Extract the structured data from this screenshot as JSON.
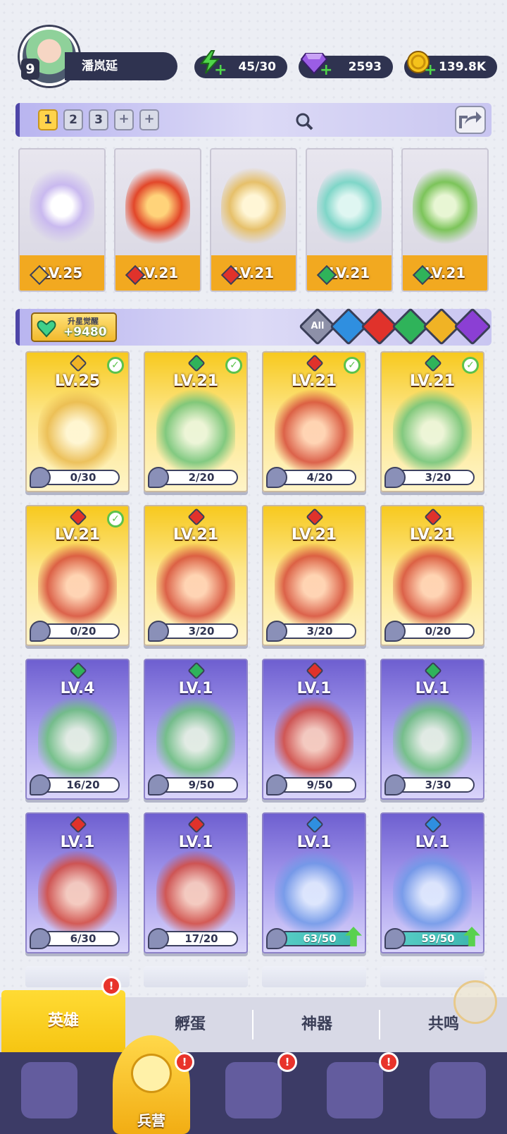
{
  "player": {
    "level": "9",
    "name": "潘岚延"
  },
  "resources": {
    "energy": "45/30",
    "gems": "2593",
    "gold": "139.8K"
  },
  "team": {
    "slots": [
      "1",
      "2",
      "3"
    ],
    "add_label": "+",
    "members": [
      {
        "level": "LV.25",
        "element": "light"
      },
      {
        "level": "LV.21",
        "element": "fire"
      },
      {
        "level": "LV.21",
        "element": "fire"
      },
      {
        "level": "LV.21",
        "element": "nature"
      },
      {
        "level": "LV.21",
        "element": "nature"
      }
    ]
  },
  "awaken": {
    "title": "升星觉醒",
    "value": "+9480"
  },
  "filters": [
    "All",
    "water",
    "fire",
    "nature",
    "light",
    "dark"
  ],
  "filter_all_label": "All",
  "heroes": [
    {
      "level": "LV.25",
      "progress": "0/30",
      "element": "light",
      "rarity": "gold",
      "checked": true,
      "upgrade": false
    },
    {
      "level": "LV.21",
      "progress": "2/20",
      "element": "nature",
      "rarity": "gold",
      "checked": true,
      "upgrade": false
    },
    {
      "level": "LV.21",
      "progress": "4/20",
      "element": "fire",
      "rarity": "gold",
      "checked": true,
      "upgrade": false
    },
    {
      "level": "LV.21",
      "progress": "3/20",
      "element": "nature",
      "rarity": "gold",
      "checked": true,
      "upgrade": false
    },
    {
      "level": "LV.21",
      "progress": "0/20",
      "element": "fire",
      "rarity": "gold",
      "checked": true,
      "upgrade": false
    },
    {
      "level": "LV.21",
      "progress": "3/20",
      "element": "fire",
      "rarity": "gold",
      "checked": false,
      "upgrade": false
    },
    {
      "level": "LV.21",
      "progress": "3/20",
      "element": "fire",
      "rarity": "gold",
      "checked": false,
      "upgrade": false
    },
    {
      "level": "LV.21",
      "progress": "0/20",
      "element": "fire",
      "rarity": "gold",
      "checked": false,
      "upgrade": false
    },
    {
      "level": "LV.4",
      "progress": "16/20",
      "element": "nature",
      "rarity": "purple",
      "checked": false,
      "upgrade": false
    },
    {
      "level": "LV.1",
      "progress": "9/50",
      "element": "nature",
      "rarity": "purple",
      "checked": false,
      "upgrade": false
    },
    {
      "level": "LV.1",
      "progress": "9/50",
      "element": "fire",
      "rarity": "purple",
      "checked": false,
      "upgrade": false
    },
    {
      "level": "LV.1",
      "progress": "3/30",
      "element": "nature",
      "rarity": "purple",
      "checked": false,
      "upgrade": false
    },
    {
      "level": "LV.1",
      "progress": "6/30",
      "element": "fire",
      "rarity": "purple",
      "checked": false,
      "upgrade": false
    },
    {
      "level": "LV.1",
      "progress": "17/20",
      "element": "fire",
      "rarity": "purple",
      "checked": false,
      "upgrade": false
    },
    {
      "level": "LV.1",
      "progress": "63/50",
      "element": "water",
      "rarity": "purple",
      "checked": false,
      "upgrade": true
    },
    {
      "level": "LV.1",
      "progress": "59/50",
      "element": "water",
      "rarity": "purple",
      "checked": false,
      "upgrade": true
    }
  ],
  "subtabs": [
    {
      "label": "英雄",
      "active": true,
      "badge": "!"
    },
    {
      "label": "孵蛋",
      "active": false
    },
    {
      "label": "神器",
      "active": false
    },
    {
      "label": "共鸣",
      "active": false
    }
  ],
  "bottom_nav": [
    {
      "name": "cards",
      "badge": ""
    },
    {
      "name": "barracks",
      "label": "兵营",
      "badge": "!"
    },
    {
      "name": "map",
      "badge": "!"
    },
    {
      "name": "castle",
      "badge": "!"
    },
    {
      "name": "mushroom",
      "badge": ""
    }
  ],
  "colors": {
    "gold_card": "#f7c91e",
    "purple_card": "#6e5fd0",
    "fire": "#e0322b",
    "water": "#2f8fe0",
    "nature": "#2fb35a",
    "light": "#f0b325",
    "dark": "#8b3fd4",
    "accent": "#ffd34a",
    "nav_bg": "#3c3b66"
  }
}
